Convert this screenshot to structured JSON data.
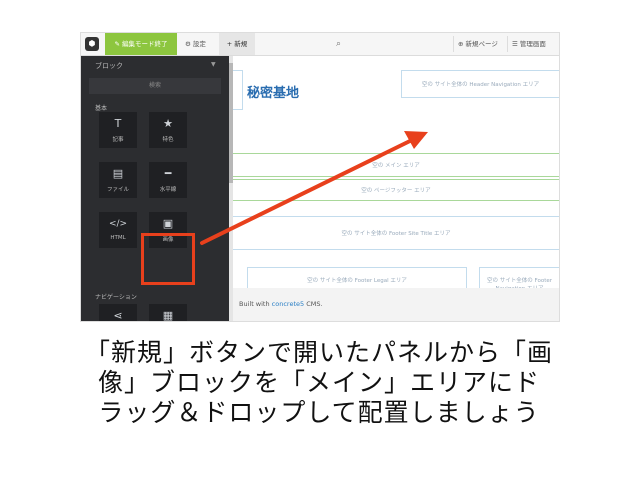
{
  "toolbar": {
    "logo": "⬢",
    "edit_mode": "✎ 編集モード終了",
    "settings": "⚙ 設定",
    "new": "+ 新規",
    "search_icon": "search-icon",
    "new_page": "⊕ 新規ページ",
    "admin": "☰ 管理画面"
  },
  "panel": {
    "title": "ブロック",
    "search_placeholder": "検索",
    "section_basic": "基本",
    "section_nav": "ナビゲーション",
    "blocks": [
      {
        "icon": "T",
        "label": "記事"
      },
      {
        "icon": "★",
        "label": "特色"
      },
      {
        "icon": "▤",
        "label": "ファイル"
      },
      {
        "icon": "━",
        "label": "水平線"
      },
      {
        "icon": "</>",
        "label": "HTML"
      },
      {
        "icon": "▣",
        "label": "画像"
      }
    ],
    "nav_blocks": [
      {
        "icon": "⋖"
      },
      {
        "icon": "▦"
      }
    ]
  },
  "page": {
    "site_title": "秘密基地",
    "header_nav_area": "空の サイト全体の Header Navigation エリア",
    "main_area": "空の メイン エリア",
    "page_footer_area": "空の ページフッター エリア",
    "footer_title_area": "空の サイト全体の Footer Site Title エリア",
    "footer_legal_area": "空の サイト全体の Footer Legal エリア",
    "footer_nav_area": "空の サイト全体の Footer Navigation エリア",
    "built_with_prefix": "Built with ",
    "built_with_link": "concrete5",
    "built_with_suffix": " CMS."
  },
  "caption": {
    "line1": "「新規」ボタンで開いたパネルから「画",
    "line2": "像」ブロックを「メイン」エリアにド",
    "line3": "ラッグ＆ドロップして配置しましょう"
  },
  "colors": {
    "highlight": "#e8401c",
    "edit_mode_bg": "#8dc63f",
    "panel_bg": "#2c2d30",
    "title_blue": "#2a6db0"
  }
}
